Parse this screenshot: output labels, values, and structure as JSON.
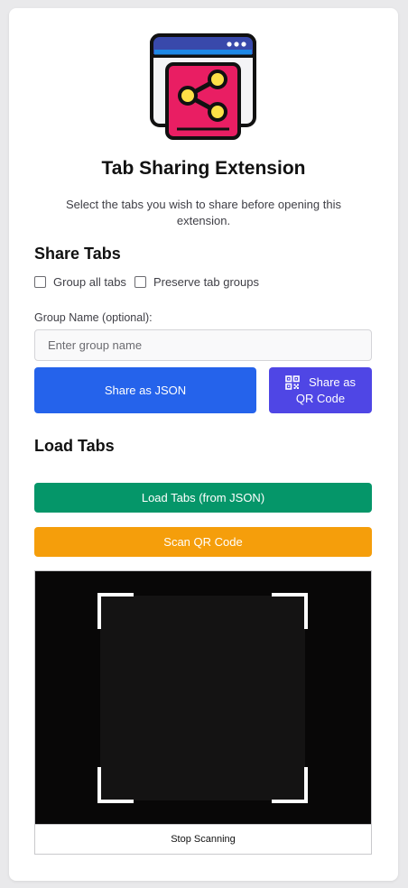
{
  "header": {
    "logo_icon": "browser-share-icon",
    "title": "Tab Sharing Extension",
    "subtitle": "Select the tabs you wish to share before opening this extension."
  },
  "share": {
    "heading": "Share Tabs",
    "group_all_label": "Group all tabs",
    "group_all_checked": false,
    "preserve_groups_label": "Preserve tab groups",
    "preserve_groups_checked": false,
    "group_name_label": "Group Name (optional):",
    "group_name_value": "",
    "group_name_placeholder": "Enter group name",
    "json_button_label": "Share as JSON",
    "qr_button_icon": "qr-code-icon",
    "qr_button_label_line1": "Share as",
    "qr_button_label_line2": "QR Code"
  },
  "load": {
    "heading": "Load Tabs",
    "load_json_button_label": "Load Tabs (from JSON)",
    "scan_qr_button_label": "Scan QR Code",
    "stop_scanning_label": "Stop Scanning"
  },
  "colors": {
    "share_json": "#2563eb",
    "share_qr": "#4f46e5",
    "load_json": "#059669",
    "scan_qr": "#f59e0b",
    "logo_frame": "#1e88e5",
    "logo_header": "#3949ab",
    "logo_card": "#e91e63",
    "logo_nodes": "#fde047"
  }
}
